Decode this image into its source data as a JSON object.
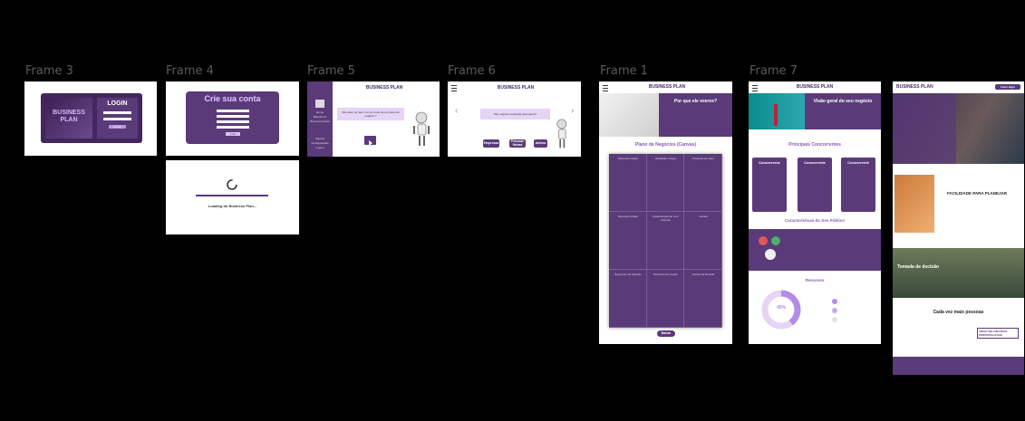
{
  "frames": {
    "frame3": {
      "label": "Frame 3",
      "brand": "BUSINESS PLAN",
      "login_title": "LOGIN",
      "login_button": "Entrar"
    },
    "frame4": {
      "label": "Frame 4",
      "title": "Crie sua conta",
      "button": "Criar"
    },
    "loading": {
      "text": "Loading do Business Plan..."
    },
    "frame5": {
      "label": "Frame 5",
      "header": "BUSINESS PLAN",
      "side_items": [
        "Home",
        "Brainstorm",
        "Business Model",
        "Suporte",
        "Configurações",
        "Logout"
      ],
      "question": "Olá, além do fato 1 ou tem tudo de um plano de negócio ?"
    },
    "frame6": {
      "label": "Frame 6",
      "header": "BUSINESS PLAN",
      "question": "Seu negócio vende(rá) para quem?",
      "options": [
        "Empresas",
        "Pessoas físicas",
        "Ambos"
      ]
    },
    "frame1": {
      "label": "Frame 1",
      "header": "BUSINESS PLAN",
      "hero_title": "Por que ele exerce?",
      "canvas_title": "Plano de Negócios (Canvas)",
      "cells": [
        "Parcerias Chave",
        "Atividades Chave",
        "Proposta de Valor",
        "Recursos Chave",
        "Relacionamento com Clientes",
        "Canais",
        "Segmento de Clientes",
        "Estrutura de Custos",
        "Fontes de Receita"
      ],
      "button": "Baixar"
    },
    "frame7": {
      "label": "Frame 7",
      "header": "BUSINESS PLAN",
      "hero_title": "Visão geral do seu negócio",
      "competitors_title": "Principais Concorrentes",
      "competitor_card": "Concorrente",
      "audience_title": "Características do Seu Público",
      "resources_title": "Recursos",
      "percent": "40%"
    },
    "landing": {
      "header": "BUSINESS PLAN",
      "header_button": "Fazer login",
      "feature1": "FACILIDADE PARA PLANEJAR",
      "feature2": "Tomada de decisão",
      "footer_title": "Cada vez mais pessoas",
      "footer_cta": "CRIAR SEU NEGÓCIO PERSONALIZADO"
    }
  },
  "colors": {
    "accent": "#5a3a79",
    "lilac": "#e9d9f6",
    "canvas": "#000000"
  }
}
